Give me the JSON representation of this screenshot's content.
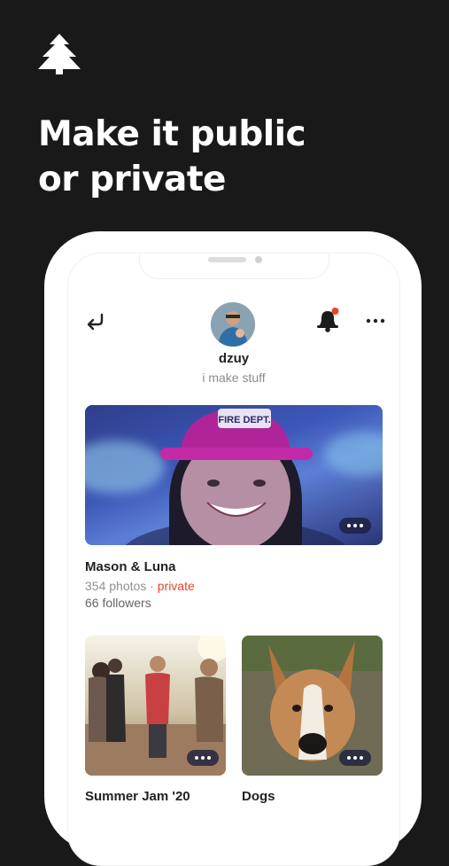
{
  "headline": {
    "line1": "Make it public",
    "line2": "or private"
  },
  "profile": {
    "username": "dzuy",
    "bio": "i make stuff"
  },
  "albums": [
    {
      "title": "Mason & Luna",
      "photos": "354 photos",
      "separator": " · ",
      "visibility": "private",
      "followers": "66 followers"
    },
    {
      "title": "Summer Jam '20"
    },
    {
      "title": "Dogs"
    }
  ],
  "hero_text": "FIRE DEPT.",
  "colors": {
    "background": "#191919",
    "accent": "#e6452a",
    "notification_dot": "#e6452a"
  },
  "icons": [
    "tree-logo-icon",
    "back-arrow-icon",
    "bell-icon",
    "more-icon",
    "album-options-icon"
  ]
}
